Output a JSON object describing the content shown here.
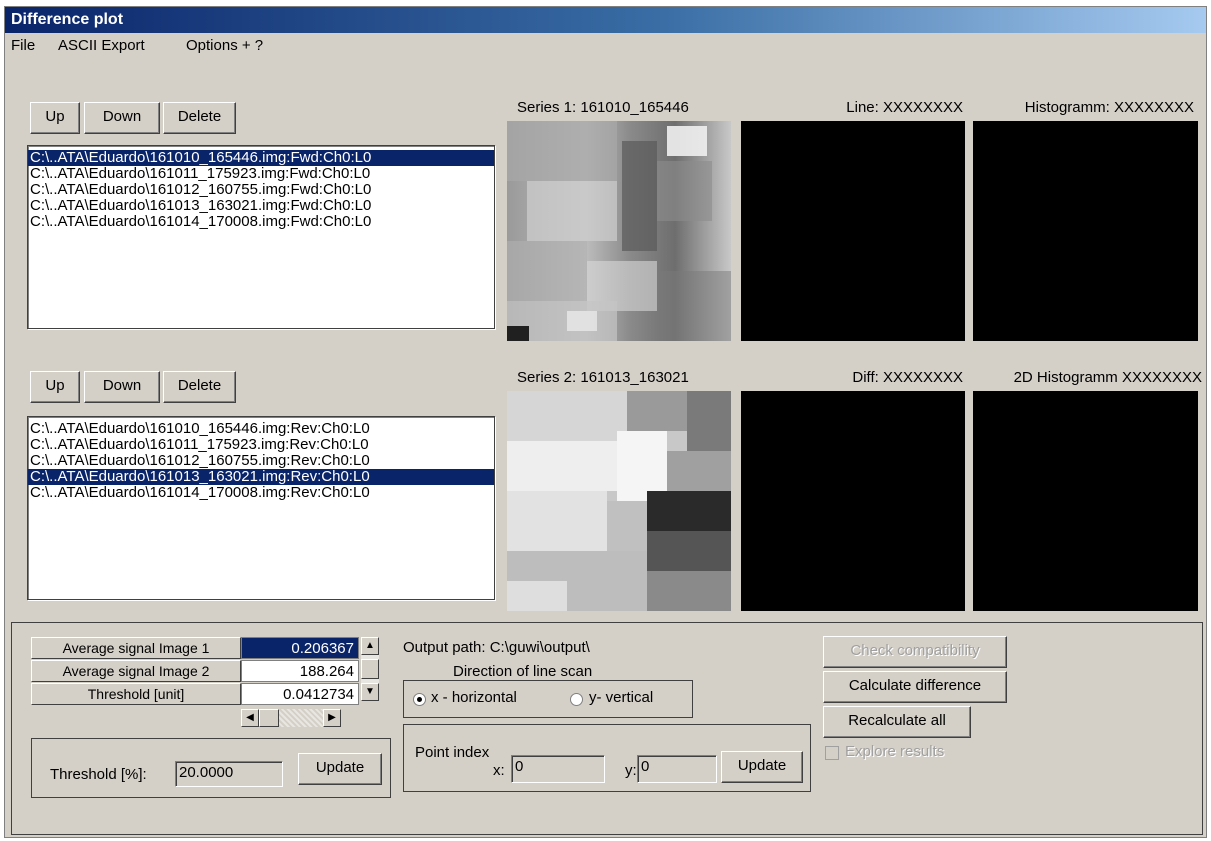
{
  "window": {
    "title": "Difference plot"
  },
  "menu": {
    "file": "File",
    "ascii_export": "ASCII Export",
    "options": "Options + ?"
  },
  "list1": {
    "buttons": {
      "up": "Up",
      "down": "Down",
      "delete": "Delete"
    },
    "items": [
      "C:\\..ATA\\Eduardo\\161010_165446.img:Fwd:Ch0:L0",
      "C:\\..ATA\\Eduardo\\161011_175923.img:Fwd:Ch0:L0",
      "C:\\..ATA\\Eduardo\\161012_160755.img:Fwd:Ch0:L0",
      "C:\\..ATA\\Eduardo\\161013_163021.img:Fwd:Ch0:L0",
      "C:\\..ATA\\Eduardo\\161014_170008.img:Fwd:Ch0:L0"
    ],
    "selected_index": 0
  },
  "list2": {
    "buttons": {
      "up": "Up",
      "down": "Down",
      "delete": "Delete"
    },
    "items": [
      "C:\\..ATA\\Eduardo\\161010_165446.img:Rev:Ch0:L0",
      "C:\\..ATA\\Eduardo\\161011_175923.img:Rev:Ch0:L0",
      "C:\\..ATA\\Eduardo\\161012_160755.img:Rev:Ch0:L0",
      "C:\\..ATA\\Eduardo\\161013_163021.img:Rev:Ch0:L0",
      "C:\\..ATA\\Eduardo\\161014_170008.img:Rev:Ch0:L0"
    ],
    "selected_index": 3
  },
  "panels": {
    "series1": "Series 1: 161010_165446",
    "line": "Line: XXXXXXXX",
    "histogram": "Histogramm: XXXXXXXX",
    "series2": "Series 2: 161013_163021",
    "diff": "Diff: XXXXXXXX",
    "histogram2d": "2D Histogramm XXXXXXXX"
  },
  "stats": {
    "rows": [
      {
        "label": "Average signal Image 1",
        "value": "0.206367"
      },
      {
        "label": "Average signal Image 2",
        "value": "188.264"
      },
      {
        "label": "Threshold [unit]",
        "value": "0.0412734"
      }
    ]
  },
  "threshold": {
    "label": "Threshold [%]:",
    "value": "20.0000",
    "update": "Update"
  },
  "output": {
    "path": "Output path: C:\\guwi\\output\\",
    "direction_label": "Direction of line scan",
    "x_option": "x - horizontal",
    "y_option": "y- vertical",
    "selected": "x"
  },
  "point": {
    "label": "Point index",
    "x_label": "x:",
    "x_value": "0",
    "y_label": "y:",
    "y_value": "0",
    "update": "Update"
  },
  "actions": {
    "check": "Check compatibility",
    "calculate": "Calculate difference",
    "recalculate": "Recalculate all",
    "explore": "Explore results"
  },
  "colors": {
    "title_start": "#0a246a",
    "title_end": "#a6caf0",
    "selection": "#0a246a",
    "face": "#d4d0c8"
  }
}
